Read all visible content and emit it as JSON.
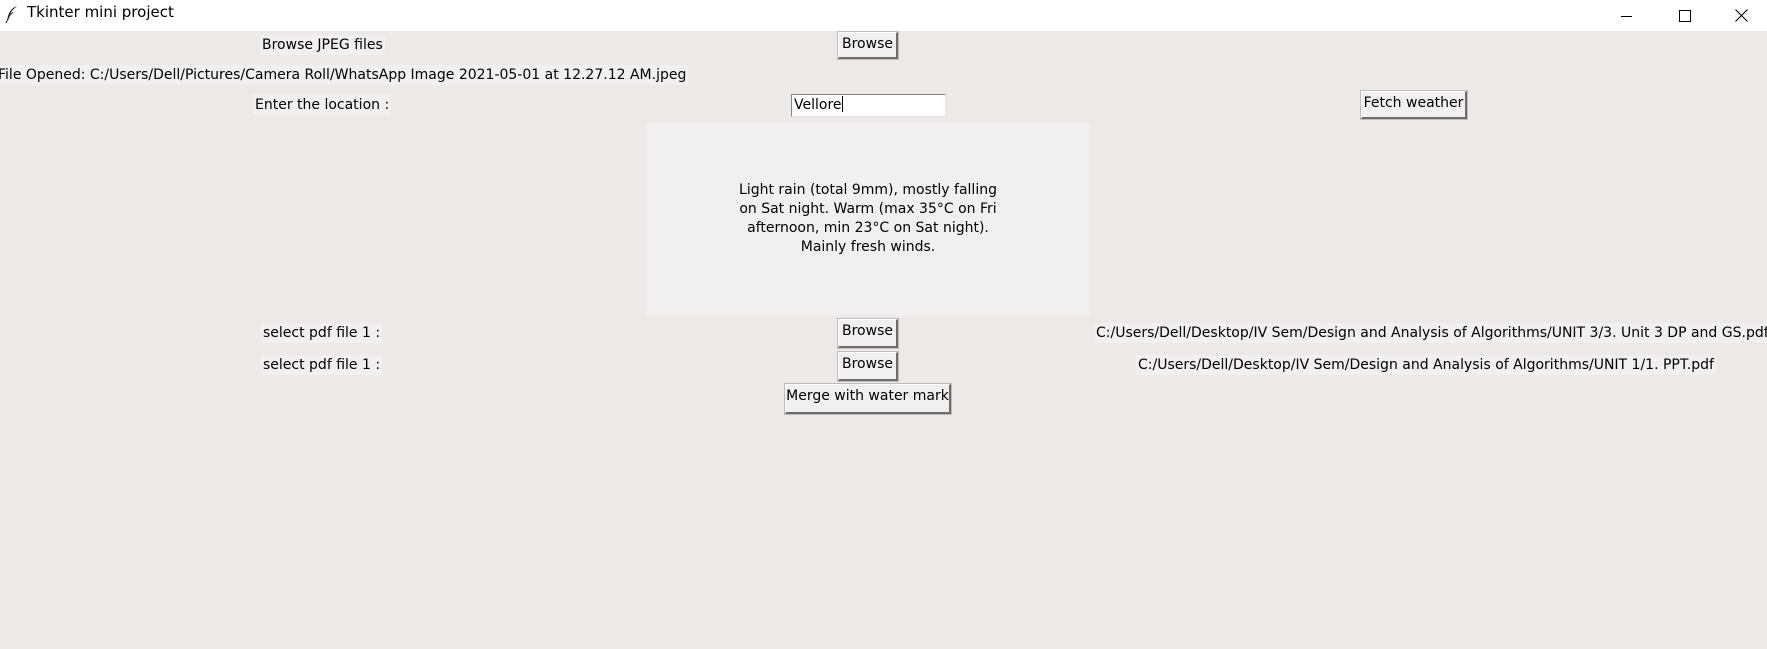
{
  "window": {
    "title": "Tkinter mini project",
    "icon": "feather-icon",
    "controls": [
      "minimize-icon",
      "maximize-icon",
      "close-icon"
    ]
  },
  "jpeg": {
    "label": "Browse JPEG files",
    "browse_label": "Browse",
    "file_opened": "File Opened: C:/Users/Dell/Pictures/Camera Roll/WhatsApp Image 2021-05-01 at 12.27.12 AM.jpeg"
  },
  "location": {
    "label": "Enter the location :",
    "value": "Vellore",
    "fetch_label": "Fetch weather"
  },
  "weather": {
    "text": "Light rain (total 9mm), mostly falling on Sat night. Warm (max 35°C on Fri afternoon, min 23°C on Sat night). Mainly fresh winds."
  },
  "pdf": {
    "file1": {
      "label": "select pdf file 1 :",
      "browse_label": "Browse",
      "path": "C:/Users/Dell/Desktop/IV Sem/Design and Analysis of Algorithms/UNIT 3/3. Unit 3 DP and GS.pdf"
    },
    "file2": {
      "label": "select pdf file 1 :",
      "browse_label": "Browse",
      "path": "C:/Users/Dell/Desktop/IV Sem/Design and Analysis of Algorithms/UNIT 1/1. PPT.pdf"
    },
    "merge_label": "Merge with water mark"
  },
  "colors": {
    "window_bg": "#ECE9E8",
    "widget_bg": "#F0F0F0",
    "titlebar_bg": "#FFFFFF"
  }
}
